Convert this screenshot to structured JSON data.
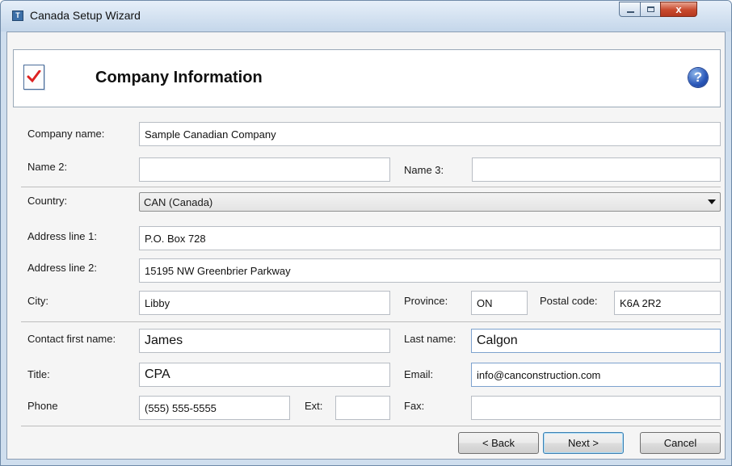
{
  "window": {
    "title": "Canada Setup Wizard",
    "icon": "app-icon",
    "close_glyph": "x"
  },
  "header": {
    "title": "Company Information",
    "icon": "checklist-document-icon",
    "help_glyph": "?"
  },
  "company": {
    "name_label": "Company name:",
    "name_value": "Sample Canadian Company",
    "name2_label": "Name 2:",
    "name2_value": "",
    "name3_label": "Name 3:",
    "name3_value": ""
  },
  "address": {
    "country_label": "Country:",
    "country_value": "CAN (Canada)",
    "line1_label": "Address line 1:",
    "line1_value": "P.O. Box 728",
    "line2_label": "Address line 2:",
    "line2_value": "15195 NW Greenbrier Parkway",
    "city_label": "City:",
    "city_value": "Libby",
    "province_label": "Province:",
    "province_value": "ON",
    "postal_label": "Postal code:",
    "postal_value": "K6A 2R2"
  },
  "contact": {
    "first_label": "Contact first name:",
    "first_value": "James",
    "last_label": "Last name:",
    "last_value": "Calgon",
    "title_label": "Title:",
    "title_value": "CPA",
    "email_label": "Email:",
    "email_value": "info@canconstruction.com",
    "phone_label": "Phone",
    "phone_value": "(555) 555-5555",
    "ext_label": "Ext:",
    "ext_value": "",
    "fax_label": "Fax:",
    "fax_value": ""
  },
  "buttons": {
    "back": "< Back",
    "next": "Next >",
    "cancel": "Cancel"
  }
}
